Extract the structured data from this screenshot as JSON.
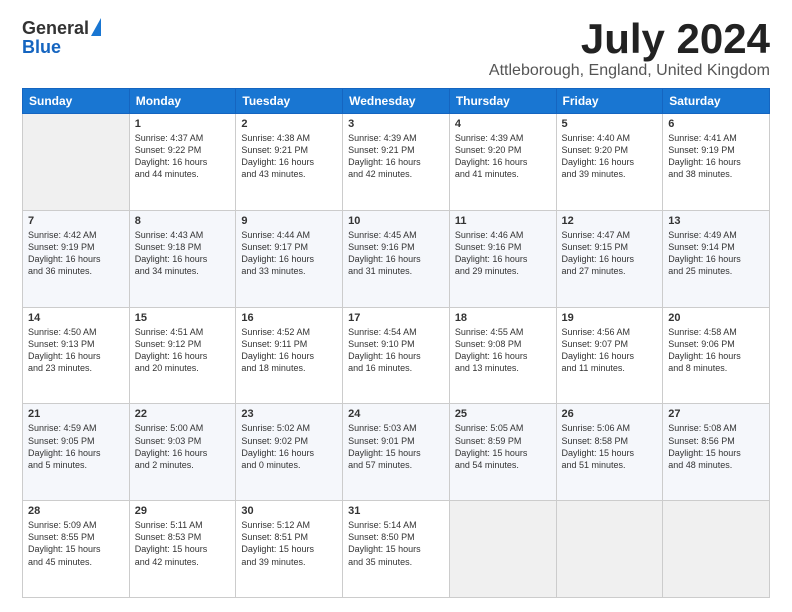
{
  "header": {
    "logo_general": "General",
    "logo_blue": "Blue",
    "month_title": "July 2024",
    "location": "Attleborough, England, United Kingdom"
  },
  "days_of_week": [
    "Sunday",
    "Monday",
    "Tuesday",
    "Wednesday",
    "Thursday",
    "Friday",
    "Saturday"
  ],
  "weeks": [
    [
      {
        "date": "",
        "info": ""
      },
      {
        "date": "1",
        "info": "Sunrise: 4:37 AM\nSunset: 9:22 PM\nDaylight: 16 hours\nand 44 minutes."
      },
      {
        "date": "2",
        "info": "Sunrise: 4:38 AM\nSunset: 9:21 PM\nDaylight: 16 hours\nand 43 minutes."
      },
      {
        "date": "3",
        "info": "Sunrise: 4:39 AM\nSunset: 9:21 PM\nDaylight: 16 hours\nand 42 minutes."
      },
      {
        "date": "4",
        "info": "Sunrise: 4:39 AM\nSunset: 9:20 PM\nDaylight: 16 hours\nand 41 minutes."
      },
      {
        "date": "5",
        "info": "Sunrise: 4:40 AM\nSunset: 9:20 PM\nDaylight: 16 hours\nand 39 minutes."
      },
      {
        "date": "6",
        "info": "Sunrise: 4:41 AM\nSunset: 9:19 PM\nDaylight: 16 hours\nand 38 minutes."
      }
    ],
    [
      {
        "date": "7",
        "info": "Sunrise: 4:42 AM\nSunset: 9:19 PM\nDaylight: 16 hours\nand 36 minutes."
      },
      {
        "date": "8",
        "info": "Sunrise: 4:43 AM\nSunset: 9:18 PM\nDaylight: 16 hours\nand 34 minutes."
      },
      {
        "date": "9",
        "info": "Sunrise: 4:44 AM\nSunset: 9:17 PM\nDaylight: 16 hours\nand 33 minutes."
      },
      {
        "date": "10",
        "info": "Sunrise: 4:45 AM\nSunset: 9:16 PM\nDaylight: 16 hours\nand 31 minutes."
      },
      {
        "date": "11",
        "info": "Sunrise: 4:46 AM\nSunset: 9:16 PM\nDaylight: 16 hours\nand 29 minutes."
      },
      {
        "date": "12",
        "info": "Sunrise: 4:47 AM\nSunset: 9:15 PM\nDaylight: 16 hours\nand 27 minutes."
      },
      {
        "date": "13",
        "info": "Sunrise: 4:49 AM\nSunset: 9:14 PM\nDaylight: 16 hours\nand 25 minutes."
      }
    ],
    [
      {
        "date": "14",
        "info": "Sunrise: 4:50 AM\nSunset: 9:13 PM\nDaylight: 16 hours\nand 23 minutes."
      },
      {
        "date": "15",
        "info": "Sunrise: 4:51 AM\nSunset: 9:12 PM\nDaylight: 16 hours\nand 20 minutes."
      },
      {
        "date": "16",
        "info": "Sunrise: 4:52 AM\nSunset: 9:11 PM\nDaylight: 16 hours\nand 18 minutes."
      },
      {
        "date": "17",
        "info": "Sunrise: 4:54 AM\nSunset: 9:10 PM\nDaylight: 16 hours\nand 16 minutes."
      },
      {
        "date": "18",
        "info": "Sunrise: 4:55 AM\nSunset: 9:08 PM\nDaylight: 16 hours\nand 13 minutes."
      },
      {
        "date": "19",
        "info": "Sunrise: 4:56 AM\nSunset: 9:07 PM\nDaylight: 16 hours\nand 11 minutes."
      },
      {
        "date": "20",
        "info": "Sunrise: 4:58 AM\nSunset: 9:06 PM\nDaylight: 16 hours\nand 8 minutes."
      }
    ],
    [
      {
        "date": "21",
        "info": "Sunrise: 4:59 AM\nSunset: 9:05 PM\nDaylight: 16 hours\nand 5 minutes."
      },
      {
        "date": "22",
        "info": "Sunrise: 5:00 AM\nSunset: 9:03 PM\nDaylight: 16 hours\nand 2 minutes."
      },
      {
        "date": "23",
        "info": "Sunrise: 5:02 AM\nSunset: 9:02 PM\nDaylight: 16 hours\nand 0 minutes."
      },
      {
        "date": "24",
        "info": "Sunrise: 5:03 AM\nSunset: 9:01 PM\nDaylight: 15 hours\nand 57 minutes."
      },
      {
        "date": "25",
        "info": "Sunrise: 5:05 AM\nSunset: 8:59 PM\nDaylight: 15 hours\nand 54 minutes."
      },
      {
        "date": "26",
        "info": "Sunrise: 5:06 AM\nSunset: 8:58 PM\nDaylight: 15 hours\nand 51 minutes."
      },
      {
        "date": "27",
        "info": "Sunrise: 5:08 AM\nSunset: 8:56 PM\nDaylight: 15 hours\nand 48 minutes."
      }
    ],
    [
      {
        "date": "28",
        "info": "Sunrise: 5:09 AM\nSunset: 8:55 PM\nDaylight: 15 hours\nand 45 minutes."
      },
      {
        "date": "29",
        "info": "Sunrise: 5:11 AM\nSunset: 8:53 PM\nDaylight: 15 hours\nand 42 minutes."
      },
      {
        "date": "30",
        "info": "Sunrise: 5:12 AM\nSunset: 8:51 PM\nDaylight: 15 hours\nand 39 minutes."
      },
      {
        "date": "31",
        "info": "Sunrise: 5:14 AM\nSunset: 8:50 PM\nDaylight: 15 hours\nand 35 minutes."
      },
      {
        "date": "",
        "info": ""
      },
      {
        "date": "",
        "info": ""
      },
      {
        "date": "",
        "info": ""
      }
    ]
  ]
}
